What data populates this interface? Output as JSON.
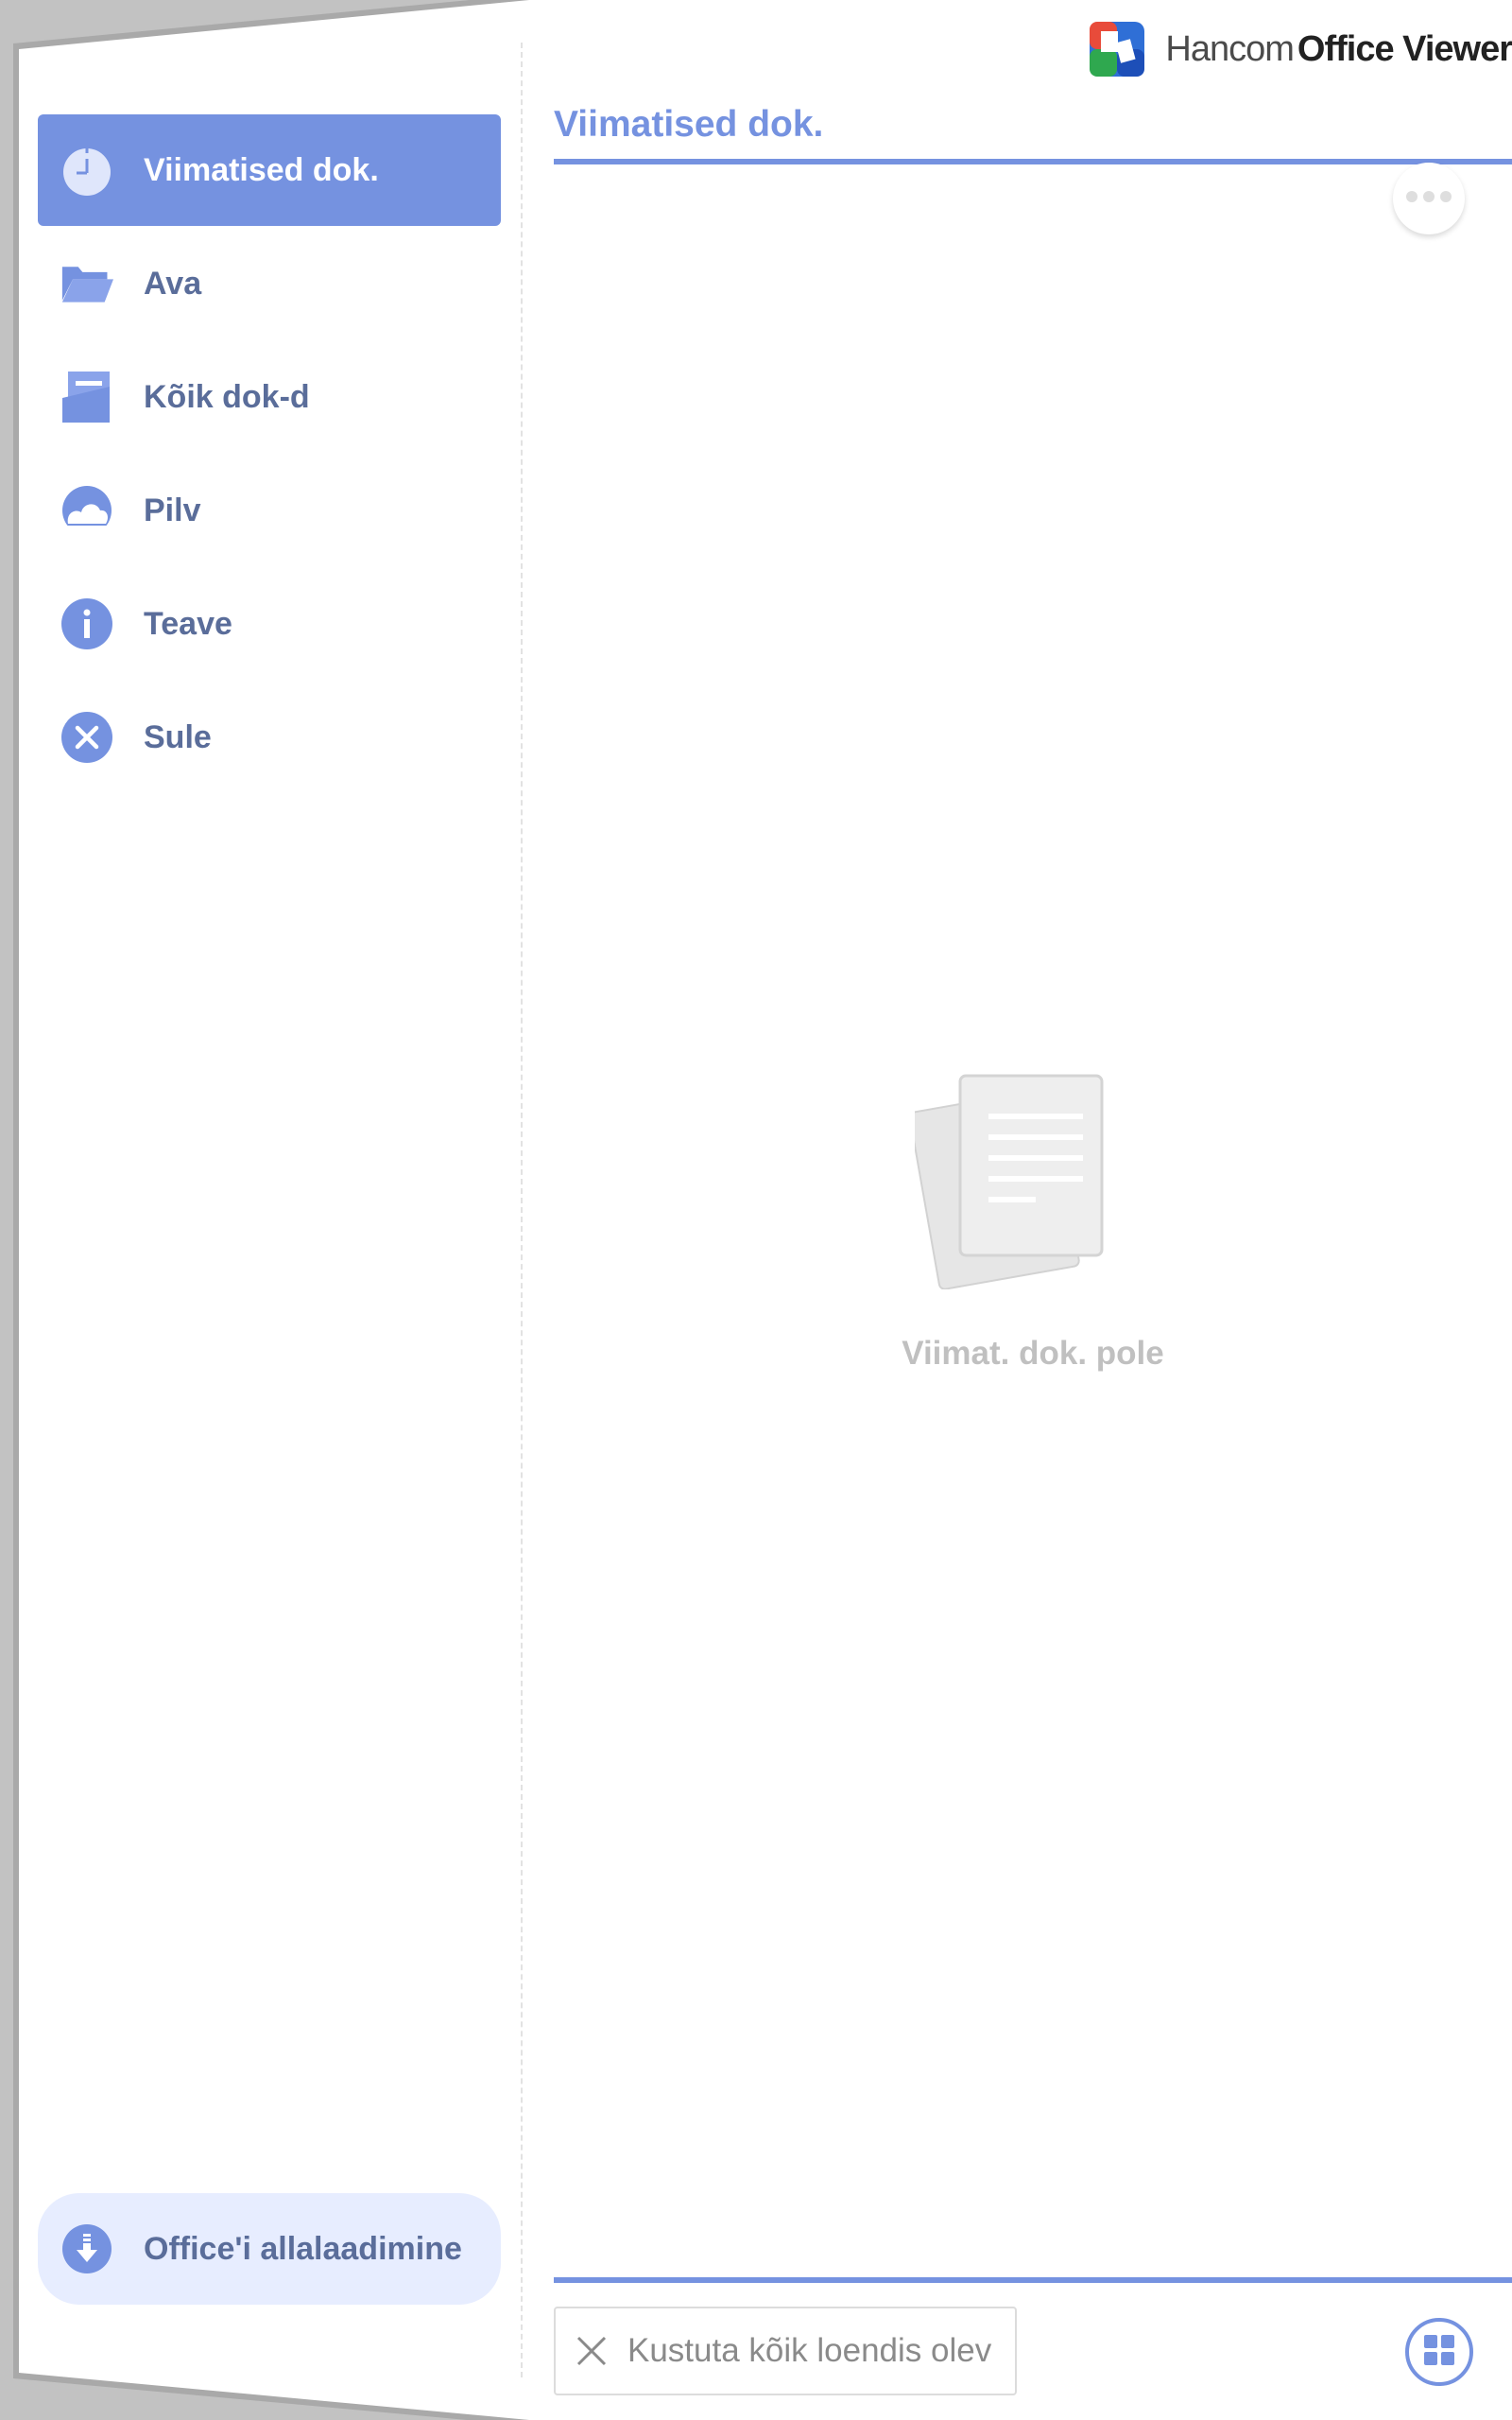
{
  "app": {
    "brand": "Hancom",
    "product": "Office Viewer"
  },
  "sidebar": {
    "items": [
      {
        "label": "Viimatised dok.",
        "icon": "clock-icon",
        "active": true
      },
      {
        "label": "Ava",
        "icon": "folder-open-icon",
        "active": false
      },
      {
        "label": "Kõik dok-d",
        "icon": "documents-icon",
        "active": false
      },
      {
        "label": "Pilv",
        "icon": "cloud-icon",
        "active": false
      },
      {
        "label": "Teave",
        "icon": "info-icon",
        "active": false
      },
      {
        "label": "Sule",
        "icon": "close-icon",
        "active": false
      }
    ],
    "download": {
      "label": "Office'i allalaadimine",
      "icon": "download-icon"
    }
  },
  "main": {
    "title": "Viimatised dok.",
    "empty_message": "Viimat. dok. pole",
    "clear_label": "Kustuta kõik loendis olev"
  },
  "colors": {
    "accent": "#7592e0",
    "sidebar_text": "#5a6d9a",
    "empty_text": "#c0c0c0"
  }
}
